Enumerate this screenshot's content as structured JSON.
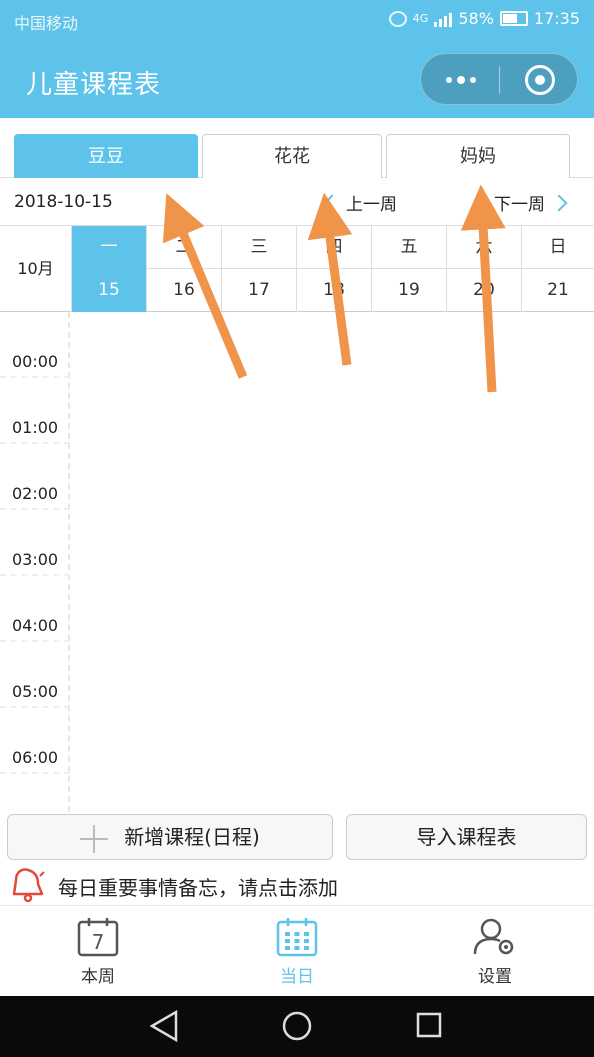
{
  "status_bar": {
    "carrier": "中国移动",
    "network": "4G",
    "battery": "58%",
    "time": "17:35"
  },
  "header": {
    "title": "儿童课程表"
  },
  "tabs": [
    {
      "label": "豆豆",
      "active": true
    },
    {
      "label": "花花",
      "active": false
    },
    {
      "label": "妈妈",
      "active": false
    }
  ],
  "week_nav": {
    "date": "2018-10-15",
    "prev_label": "上一周",
    "next_label": "下一周"
  },
  "calendar": {
    "month": "10月",
    "days": [
      {
        "weekday": "一",
        "date": "15",
        "active": true
      },
      {
        "weekday": "二",
        "date": "16",
        "active": false
      },
      {
        "weekday": "三",
        "date": "17",
        "active": false
      },
      {
        "weekday": "四",
        "date": "18",
        "active": false
      },
      {
        "weekday": "五",
        "date": "19",
        "active": false
      },
      {
        "weekday": "六",
        "date": "20",
        "active": false
      },
      {
        "weekday": "日",
        "date": "21",
        "active": false
      }
    ],
    "times": [
      "00:00",
      "01:00",
      "02:00",
      "03:00",
      "04:00",
      "05:00",
      "06:00"
    ]
  },
  "actions": {
    "add_label": "新增课程(日程)",
    "import_label": "导入课程表"
  },
  "memo": {
    "text": "每日重要事情备忘，请点击添加"
  },
  "tabbar": {
    "items": [
      {
        "label": "本周",
        "icon": "calendar-7-icon",
        "badge": "7"
      },
      {
        "label": "当日",
        "icon": "calendar-grid-icon",
        "active": true
      },
      {
        "label": "设置",
        "icon": "user-settings-icon"
      }
    ]
  },
  "colors": {
    "accent": "#5ec3ea",
    "arrow": "#f0944a"
  }
}
